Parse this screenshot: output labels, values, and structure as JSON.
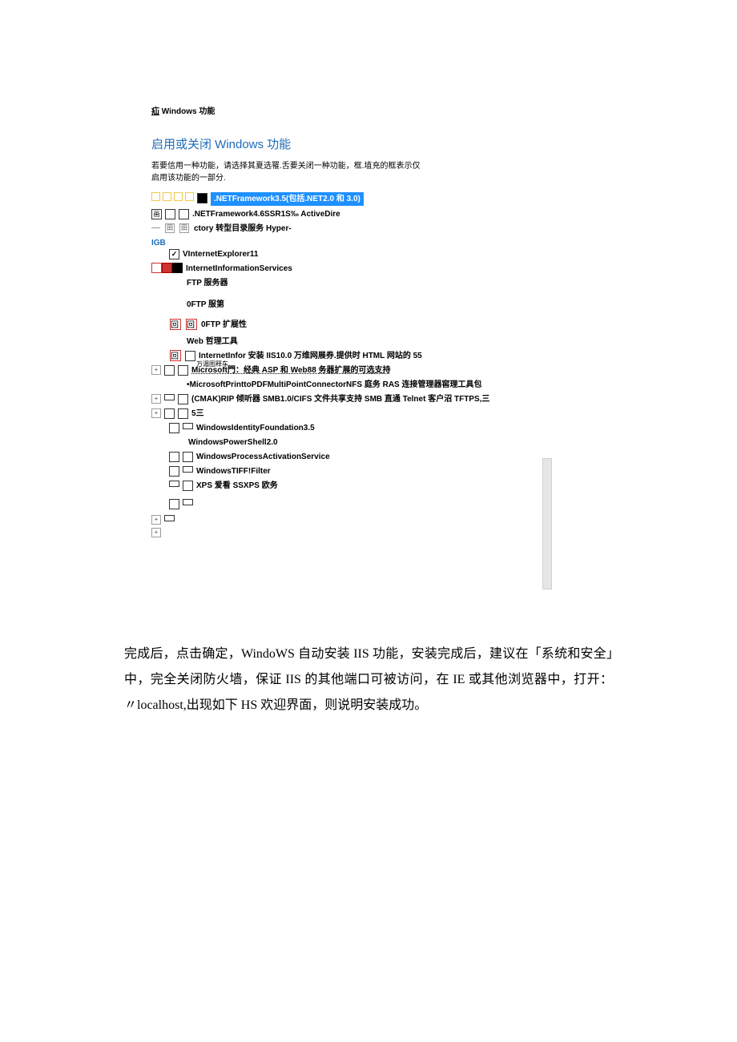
{
  "dialog": {
    "title_prefix": "疝",
    "title_main": "Windows 功能",
    "heading": "启用或关闭 Windows 功能",
    "description": "若要信用一种功能，请选择其夏选罹.舌要关闭一种功能，框.埴充的框表示仅启用该功能的一部分."
  },
  "tree": {
    "net35": ".NETFramework3.5(包括.NET2.0 和 3.0)",
    "net46": ".NETFramework4.6SSR1S‰ ActiveDire",
    "ctory_line": "ctory 转型目录服务 Hyper-",
    "igb": "IGB",
    "ie11": "VInternetExplorer11",
    "iis": "InternetInformationServices",
    "ftp_server": "FTP 服务器",
    "ftp_svc": "0FTP 服第",
    "ftp_ext": "0FTP 扩屣性",
    "web_mgmt": "Web 哲理工具",
    "internet_infor": "InternetInfor 安装 IIS10.0 万维网展券.提供时 HTML 网站的 55",
    "msft_line": "Microsoft門：经典 ASP 和 Web88 务器扩展的可选支持",
    "msft_sub": "万湄图释车",
    "msft_print": "•MicrosoftPrinttoPDFMultiPointConnectorNFS 庭务 RAS 连接管理器窖理工具包",
    "cmak": "(CMAK)RIP 倾听器 SMB1.0/CIFS 文件共享支持 SMB 直通 Telnet 客户沼 TFTPS,三",
    "five": "5三",
    "wif": "WindowsIdentityFoundation3.5",
    "ps2": "WindowsPowerShell2.0",
    "wpas": "WindowsProcessActivationService",
    "tiff": "WindowsTIFF!Filter",
    "xps": "XPS 爱看 SSXPS 欧务"
  },
  "body_paragraph": "完成后，点击确定，WindoWS 自动安装 IIS 功能，安装完成后，建议在「系统和安全」中，完全关闭防火墙，保证 IIS 的其他端口可被访问，在 IE 或其他浏览器中，打开：〃localhost,出现如下 HS 欢迎界面，则说明安装成功。"
}
